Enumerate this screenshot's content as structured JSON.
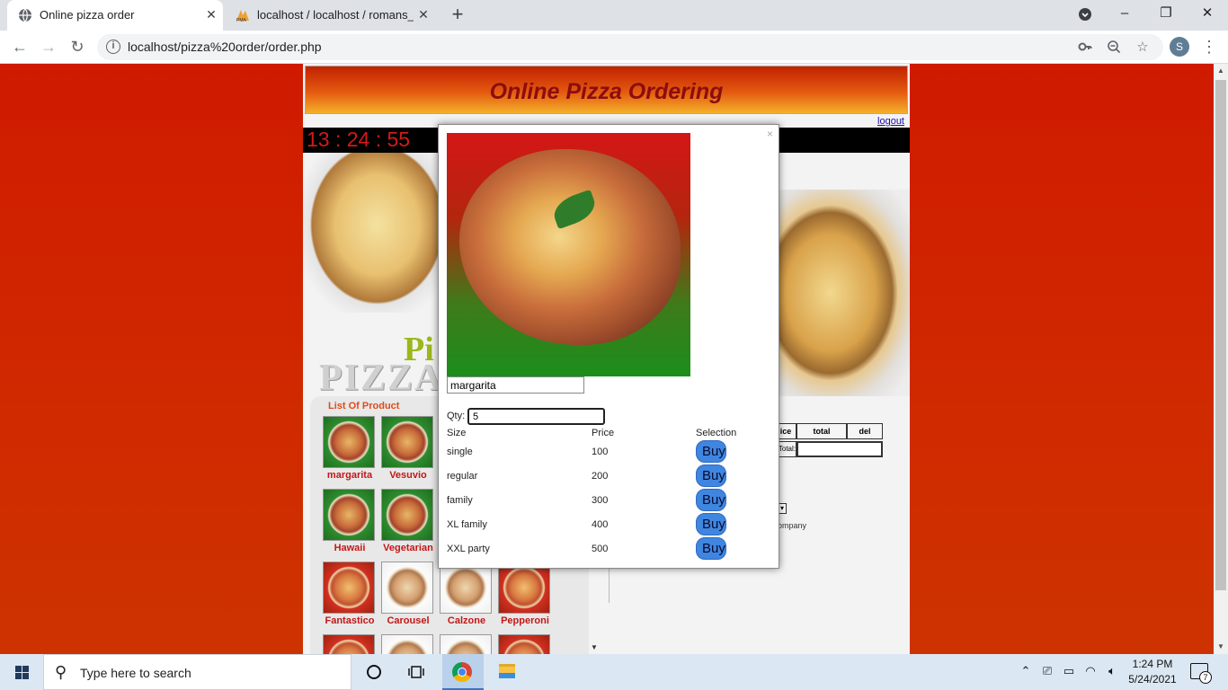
{
  "browser": {
    "tabs": [
      {
        "title": "Online pizza order",
        "icon": "globe-icon",
        "active": true
      },
      {
        "title": "localhost / localhost / romans_db",
        "icon": "phpmyadmin-icon",
        "active": false
      }
    ],
    "new_tab": "+",
    "url": "localhost/pizza%20order/order.php",
    "profile_initial": "S",
    "window_controls": {
      "minimize": "–",
      "restore": "❐",
      "close": "✕"
    },
    "dropdown": "▾"
  },
  "page": {
    "banner_title": "Online Pizza Ordering",
    "logout": "logout",
    "clock": "13 : 24 : 55",
    "watermark_pi": "Pi",
    "watermark_pizza": "PIZZA",
    "list_title": "List Of Product",
    "products": [
      {
        "name": "margarita",
        "bg": "green"
      },
      {
        "name": "Vesuvio",
        "bg": "green"
      },
      {
        "name": "Hawaii",
        "bg": "green"
      },
      {
        "name": "Vegetarian",
        "bg": "green"
      },
      {
        "name": "Fantastico",
        "bg": "red"
      },
      {
        "name": "Carousel",
        "bg": "white"
      },
      {
        "name": "Calzone",
        "bg": "white"
      },
      {
        "name": "Pepperoni",
        "bg": "red"
      }
    ],
    "cart": {
      "headers": [
        "ice",
        "total",
        "del"
      ],
      "total_label": "Total:"
    },
    "company_text": "ompany",
    "select_arrow": "▾"
  },
  "modal": {
    "close": "×",
    "product_name": "margarita",
    "qty_label": "Qty:",
    "qty_value": "5",
    "headers": {
      "size": "Size",
      "price": "Price",
      "selection": "Selection"
    },
    "rows": [
      {
        "size": "single",
        "price": "100",
        "button": "Buy"
      },
      {
        "size": "regular",
        "price": "200",
        "button": "Buy"
      },
      {
        "size": "family",
        "price": "300",
        "button": "Buy"
      },
      {
        "size": "XL family",
        "price": "400",
        "button": "Buy"
      },
      {
        "size": "XXL party",
        "price": "500",
        "button": "Buy"
      }
    ]
  },
  "taskbar": {
    "search_placeholder": "Type here to search",
    "time": "1:24 PM",
    "date": "5/24/2021",
    "notification_count": "7"
  }
}
